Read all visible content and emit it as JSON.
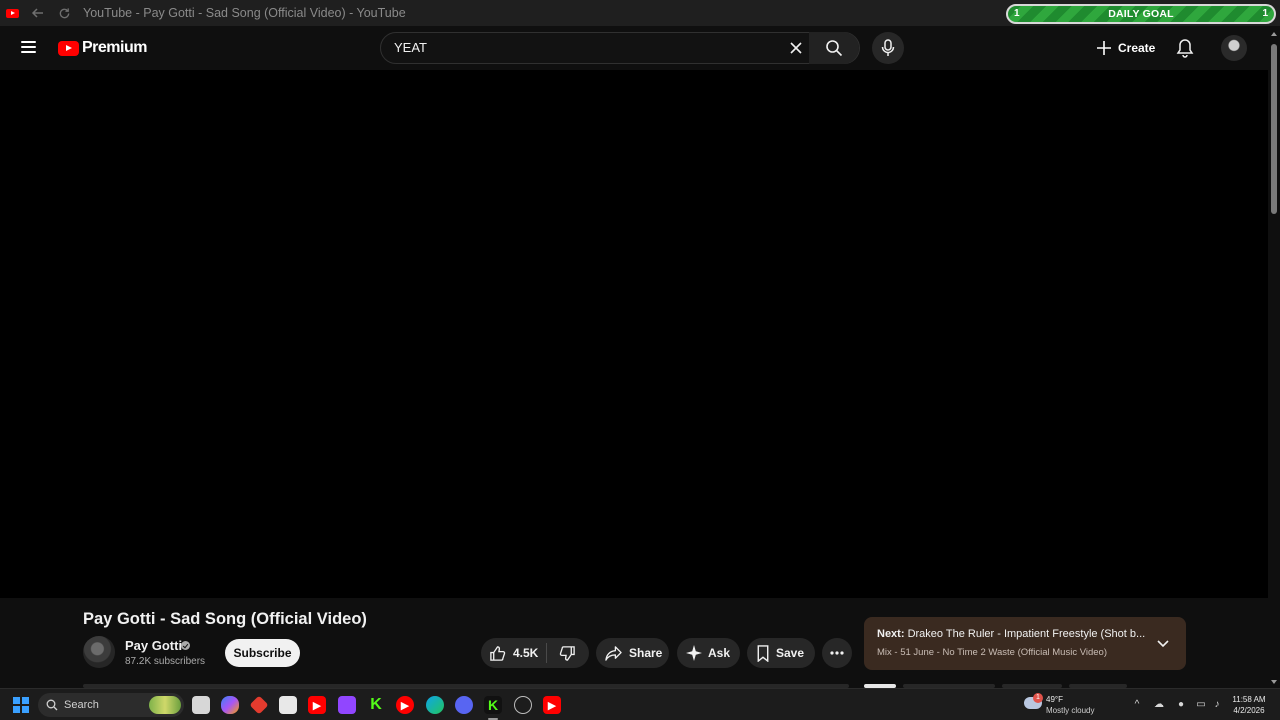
{
  "window": {
    "title": "YouTube - Pay Gotti - Sad Song (Official Video) - YouTube"
  },
  "daily_goal": {
    "left_count": "1",
    "label": "DAILY GOAL",
    "right_count": "1",
    "bar_fill_color": "#2fa73d"
  },
  "masthead": {
    "logo_text": "Premium",
    "search": {
      "value": "YEAT"
    },
    "create_label": "Create"
  },
  "video": {
    "title": "Pay Gotti - Sad Song (Official Video)",
    "channel": {
      "name": "Pay Gotti",
      "subscribers": "87.2K subscribers"
    },
    "subscribe_label": "Subscribe",
    "likes": "4.5K",
    "actions": {
      "share": "Share",
      "ask": "Ask",
      "save": "Save"
    }
  },
  "up_next": {
    "prefix": "Next:",
    "title": "Drakeo The Ruler - Impatient Freestyle (Shot b...",
    "subtitle": "Mix - 51 June - No Time 2 Waste (Official Music Video)"
  },
  "taskbar": {
    "search_label": "Search",
    "weather": {
      "temp": "49°F",
      "condition": "Mostly cloudy",
      "badge": "1"
    },
    "clock": {
      "time": "11:58 AM",
      "date": "4/2/2026"
    }
  },
  "colors": {
    "brand_red": "#ff0000",
    "background": "#0f0f0f",
    "next_card": "#3a2a20"
  }
}
